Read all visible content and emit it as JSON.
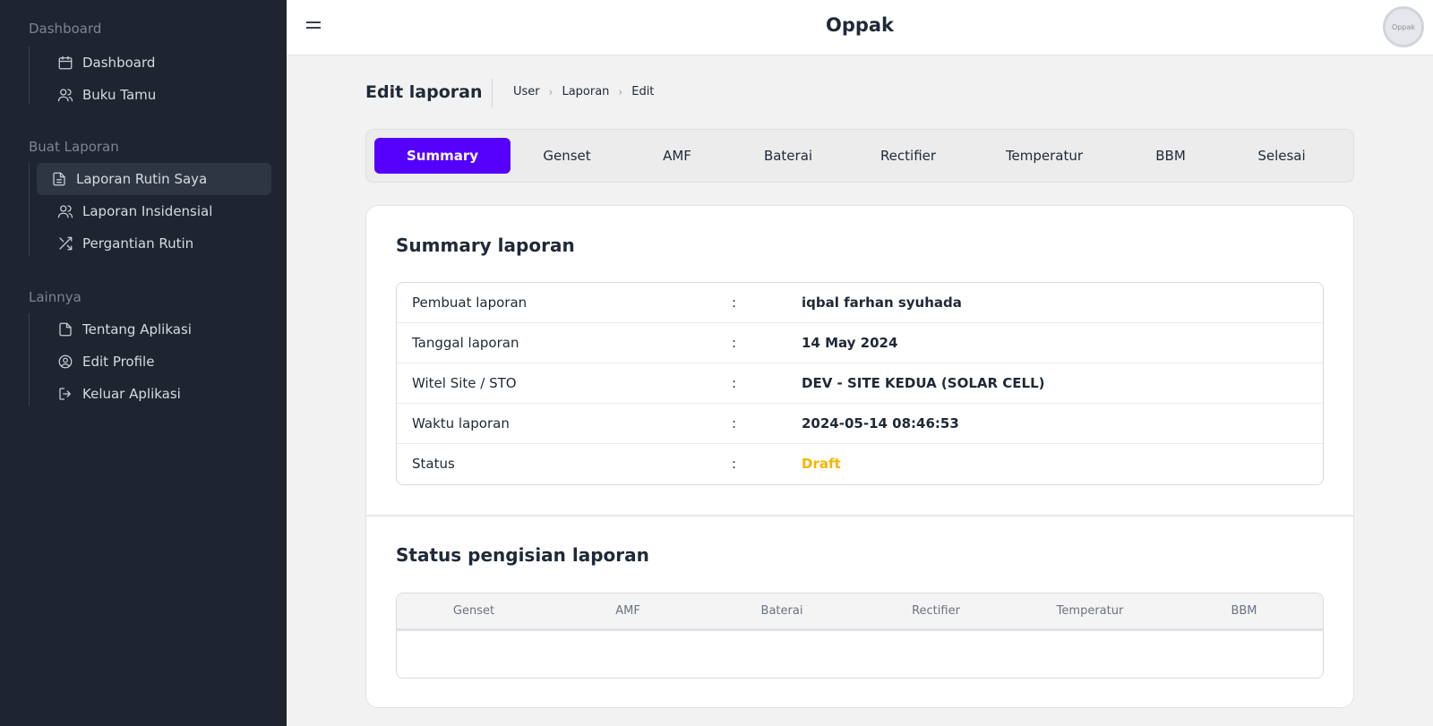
{
  "app": {
    "title": "Oppak",
    "avatar_text": "Oppak"
  },
  "sidebar": {
    "sections": [
      {
        "label": "Dashboard"
      },
      {
        "label": "Buat Laporan"
      },
      {
        "label": "Lainnya"
      }
    ],
    "items": [
      {
        "label": "Dashboard",
        "icon": "calendar-icon"
      },
      {
        "label": "Buku Tamu",
        "icon": "users-icon"
      },
      {
        "label": "Laporan Rutin Saya",
        "icon": "file-text-icon",
        "active": true
      },
      {
        "label": "Laporan Insidensial",
        "icon": "users-icon"
      },
      {
        "label": "Pergantian Rutin",
        "icon": "shuffle-icon"
      },
      {
        "label": "Tentang Aplikasi",
        "icon": "file-icon"
      },
      {
        "label": "Edit Profile",
        "icon": "user-circle-icon"
      },
      {
        "label": "Keluar Aplikasi",
        "icon": "logout-icon"
      }
    ]
  },
  "header": {
    "title": "Edit laporan",
    "breadcrumb": [
      "User",
      "Laporan",
      "Edit"
    ]
  },
  "tabs": [
    "Summary",
    "Genset",
    "AMF",
    "Baterai",
    "Rectifier",
    "Temperatur",
    "BBM",
    "Selesai"
  ],
  "active_tab": "Summary",
  "summary": {
    "title": "Summary laporan",
    "rows": [
      {
        "label": "Pembuat laporan",
        "sep": ":",
        "value": "iqbal farhan syuhada"
      },
      {
        "label": "Tanggal laporan",
        "sep": ":",
        "value": "14 May 2024"
      },
      {
        "label": "Witel Site / STO",
        "sep": ":",
        "value": "DEV - SITE KEDUA (SOLAR CELL)"
      },
      {
        "label": "Waktu laporan",
        "sep": ":",
        "value": "2024-05-14 08:46:53"
      },
      {
        "label": "Status",
        "sep": ":",
        "value": "Draft"
      }
    ]
  },
  "status_section": {
    "title": "Status pengisian laporan",
    "columns": [
      "Genset",
      "AMF",
      "Baterai",
      "Rectifier",
      "Temperatur",
      "BBM"
    ]
  },
  "colors": {
    "accent": "#5500ff",
    "sidebar_bg": "#1e2430",
    "draft": "#f5b400"
  }
}
